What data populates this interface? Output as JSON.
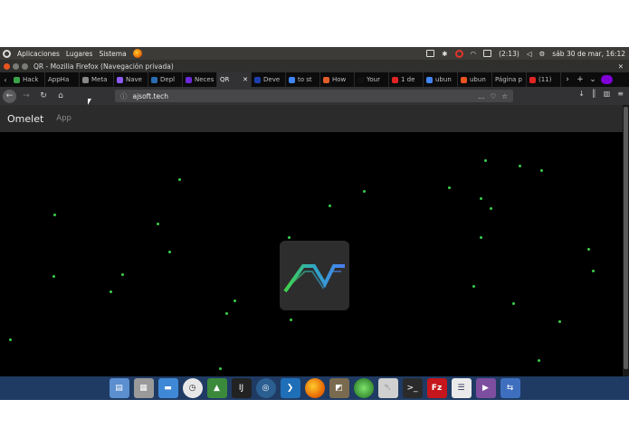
{
  "top_panel": {
    "menu_items": [
      "Aplicaciones",
      "Lugares",
      "Sistema"
    ],
    "battery": "(2:13)",
    "clock": "sáb 30 de mar, 16:12"
  },
  "window": {
    "title": "QR - Mozilla Firefox (Navegación privada)"
  },
  "tabs": [
    {
      "label": "Hack",
      "color": "#3ba34a"
    },
    {
      "label": "AppHa",
      "color": "#6b6b6b"
    },
    {
      "label": "Meta",
      "color": "#888888"
    },
    {
      "label": "Nave",
      "color": "#8b5cf6"
    },
    {
      "label": "Depl",
      "color": "#2b6cb0"
    },
    {
      "label": "Neces",
      "color": "#6d28d9"
    },
    {
      "label": "QR",
      "color": "#111111",
      "active": true
    },
    {
      "label": "Deve",
      "color": "#1e40af"
    },
    {
      "label": "to st",
      "color": "#4285f4"
    },
    {
      "label": "How",
      "color": "#e35d2a"
    },
    {
      "label": "Your",
      "color": "#111111"
    },
    {
      "label": "1 de",
      "color": "#e02424"
    },
    {
      "label": "ubun",
      "color": "#4285f4"
    },
    {
      "label": "ubun",
      "color": "#e95420"
    },
    {
      "label": "Página p",
      "color": "#666666"
    },
    {
      "label": "(11)",
      "color": "#e02424"
    }
  ],
  "toolbar": {
    "url": "ajsoft.tech",
    "url_tools": "…"
  },
  "site": {
    "brand": "Omelet",
    "nav_link": "App",
    "colors": {
      "navbar": "#2b2b2b",
      "dots": "#39d04a",
      "logo_bg": "#2d2d2d"
    }
  },
  "dock_items": [
    "files-icon",
    "archive-icon",
    "folder-icon",
    "clock-icon",
    "android-studio-icon",
    "intellij-icon",
    "browser-icon",
    "vscode-icon",
    "firefox-icon",
    "image-editor-icon",
    "green-orb-icon",
    "trash-icon",
    "terminal-icon",
    "filezilla-icon",
    "text-editor-icon",
    "media-player-icon",
    "workspace-icon"
  ]
}
